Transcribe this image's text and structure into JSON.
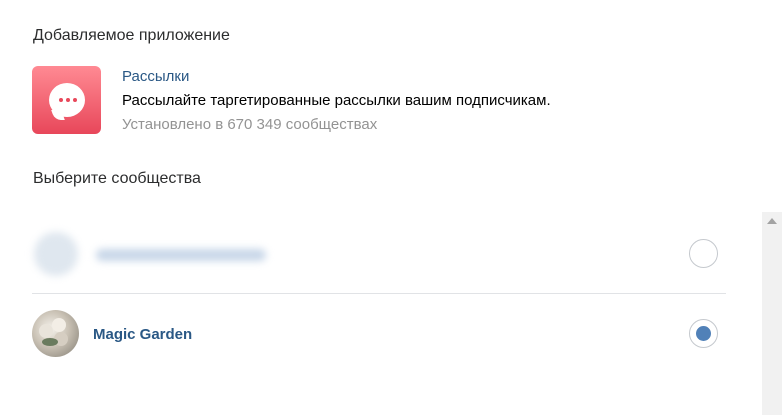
{
  "sections": {
    "app_title": "Добавляемое приложение",
    "communities_title": "Выберите сообщества"
  },
  "app": {
    "icon": "chat-bubble-icon",
    "name": "Рассылки",
    "description": "Рассылайте таргетированные рассылки вашим подписчикам.",
    "installs": "Установлено в 670 349 сообществах",
    "brand_color": "#e8475a"
  },
  "communities": [
    {
      "name": "",
      "selected": false,
      "blurred": true
    },
    {
      "name": "Magic Garden",
      "selected": true,
      "blurred": false
    }
  ],
  "colors": {
    "link": "#2a5885",
    "radio_selected": "#5181b8",
    "secondary_text": "#939393"
  }
}
